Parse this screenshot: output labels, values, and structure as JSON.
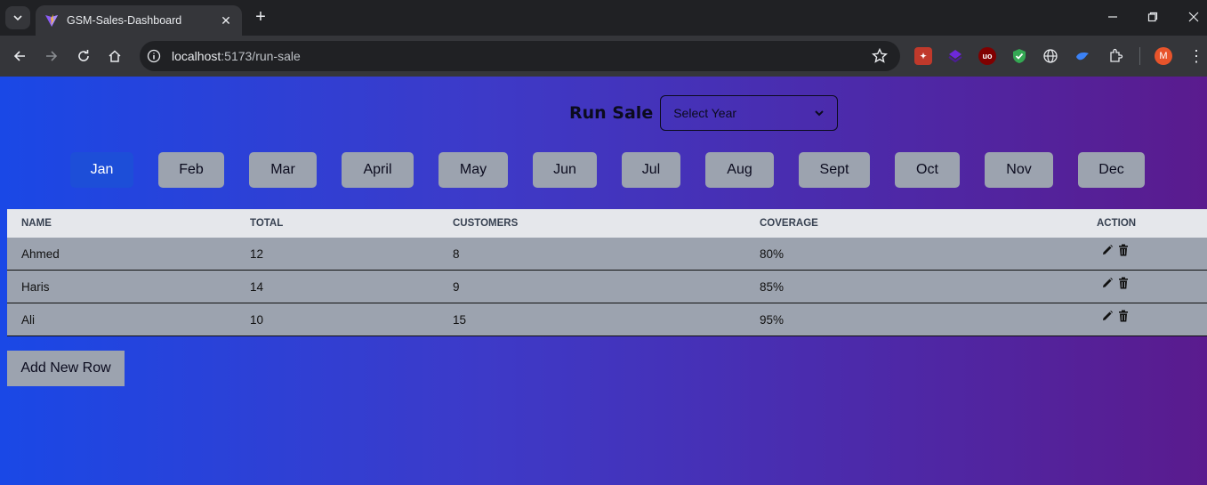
{
  "browser": {
    "tab_title": "GSM-Sales-Dashboard",
    "url_host": "localhost",
    "url_path": ":5173/run-sale",
    "avatar_letter": "M",
    "icons": [
      "tab-search-icon",
      "close-icon",
      "plus-icon",
      "minimize-icon",
      "restore-icon",
      "close-window-icon",
      "back-icon",
      "forward-icon",
      "reload-icon",
      "home-icon",
      "site-info-icon",
      "star-icon",
      "extension-icon",
      "kebab-menu-icon"
    ]
  },
  "page": {
    "heading": "Run Sale",
    "year_select": {
      "value": "Select Year"
    },
    "months": [
      "Jan",
      "Feb",
      "Mar",
      "April",
      "May",
      "Jun",
      "Jul",
      "Aug",
      "Sept",
      "Oct",
      "Nov",
      "Dec"
    ],
    "active_month": "Jan",
    "table": {
      "headers": [
        "Name",
        "Total",
        "Customers",
        "Coverage",
        "Action"
      ],
      "rows": [
        {
          "name": "Ahmed",
          "total": "12",
          "customers": "8",
          "coverage": "80%"
        },
        {
          "name": "Haris",
          "total": "14",
          "customers": "9",
          "coverage": "85%"
        },
        {
          "name": "Ali",
          "total": "10",
          "customers": "15",
          "coverage": "95%"
        }
      ]
    },
    "add_button": "Add New Row"
  },
  "colors": {
    "gradient_start": "#1a48e6",
    "gradient_end": "#5a1b8e",
    "button_gray": "#9ca3af",
    "active_month": "#1d4ed8",
    "table_header": "#e5e7eb"
  }
}
